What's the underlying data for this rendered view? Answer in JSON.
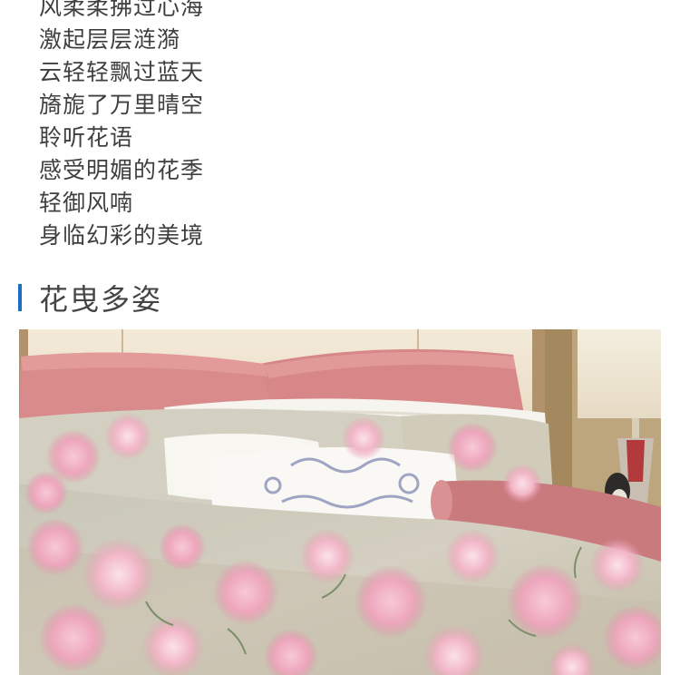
{
  "poem": {
    "lines": [
      "风柔柔拂过心海",
      "激起层层涟漪",
      "云轻轻飘过蓝天",
      "旖旎了万里晴空",
      "聆听花语",
      "感受明媚的花季",
      "轻御风喃",
      "身临幻彩的美境"
    ]
  },
  "section": {
    "title": "花曳多姿"
  },
  "colors": {
    "accent_bar": "#1a6fc4",
    "text": "#3f3f3f"
  }
}
